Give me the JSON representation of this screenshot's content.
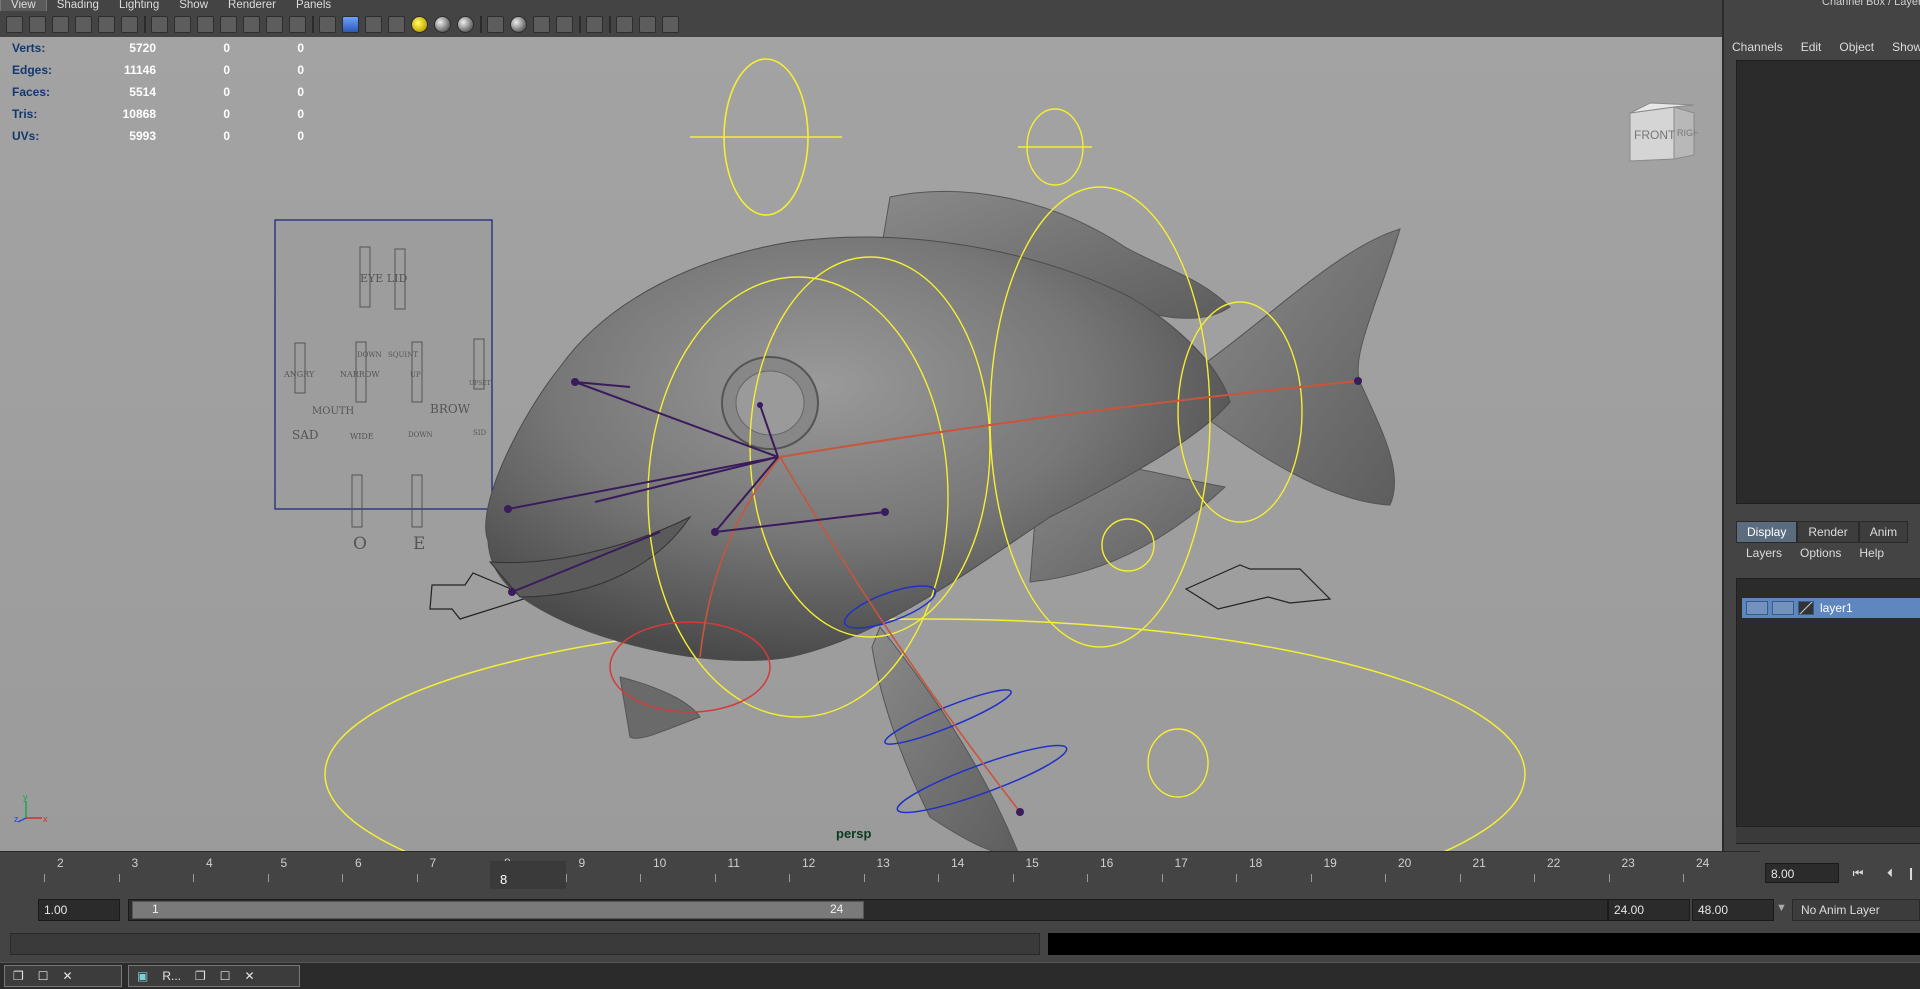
{
  "panel_menu": [
    "View",
    "Shading",
    "Lighting",
    "Show",
    "Renderer",
    "Panels"
  ],
  "hud": {
    "rows": [
      {
        "label": "Verts:",
        "values": [
          "5720",
          "0",
          "0"
        ]
      },
      {
        "label": "Edges:",
        "values": [
          "11146",
          "0",
          "0"
        ]
      },
      {
        "label": "Faces:",
        "values": [
          "5514",
          "0",
          "0"
        ]
      },
      {
        "label": "Tris:",
        "values": [
          "10868",
          "0",
          "0"
        ]
      },
      {
        "label": "UVs:",
        "values": [
          "5993",
          "0",
          "0"
        ]
      }
    ]
  },
  "viewport": {
    "camera_label": "persp",
    "view_cube": {
      "front": "FRONT",
      "right": "RIGHT"
    },
    "axis": {
      "y": "y",
      "z": "z",
      "x": "x"
    },
    "face_ui": {
      "eyelid": "EYE LID",
      "down": "DOWN",
      "squint": "SQUINT",
      "angry": "ANGRY",
      "mouth": "MOUTH",
      "sad": "SAD",
      "narrow": "NARROW",
      "wide": "WIDE",
      "up": "UP",
      "brow_down": "DOWN",
      "brow": "BROW",
      "upset": "UPSET",
      "sid": "SID",
      "o": "O",
      "e": "E"
    }
  },
  "channel_box": {
    "title": "Channel Box / Layer",
    "menu": [
      "Channels",
      "Edit",
      "Object",
      "Show"
    ]
  },
  "layer_editor": {
    "tabs": [
      "Display",
      "Render",
      "Anim"
    ],
    "active_tab": "Display",
    "menu": [
      "Layers",
      "Options",
      "Help"
    ],
    "layers": [
      {
        "name": "layer1"
      }
    ]
  },
  "time_slider": {
    "ticks": [
      "2",
      "3",
      "4",
      "5",
      "6",
      "7",
      "8",
      "9",
      "10",
      "11",
      "12",
      "13",
      "14",
      "15",
      "16",
      "17",
      "18",
      "19",
      "20",
      "21",
      "22",
      "23",
      "24"
    ],
    "current_frame": "8",
    "current_time_field": "8.00"
  },
  "range_slider": {
    "start_time": "1.00",
    "range_start": "1",
    "range_end": "24",
    "end_time": "24.00",
    "anim_end": "48.00",
    "anim_layer": "No Anim Layer"
  },
  "taskbar": {
    "window_label": "R..."
  },
  "colors": {
    "viewport_bg": "#a0a0a0",
    "ui_bg": "#444444",
    "control_yellow": "#f4ef32",
    "joint_purple": "#3a1b5c",
    "selection_blue": "#5e87bf"
  }
}
